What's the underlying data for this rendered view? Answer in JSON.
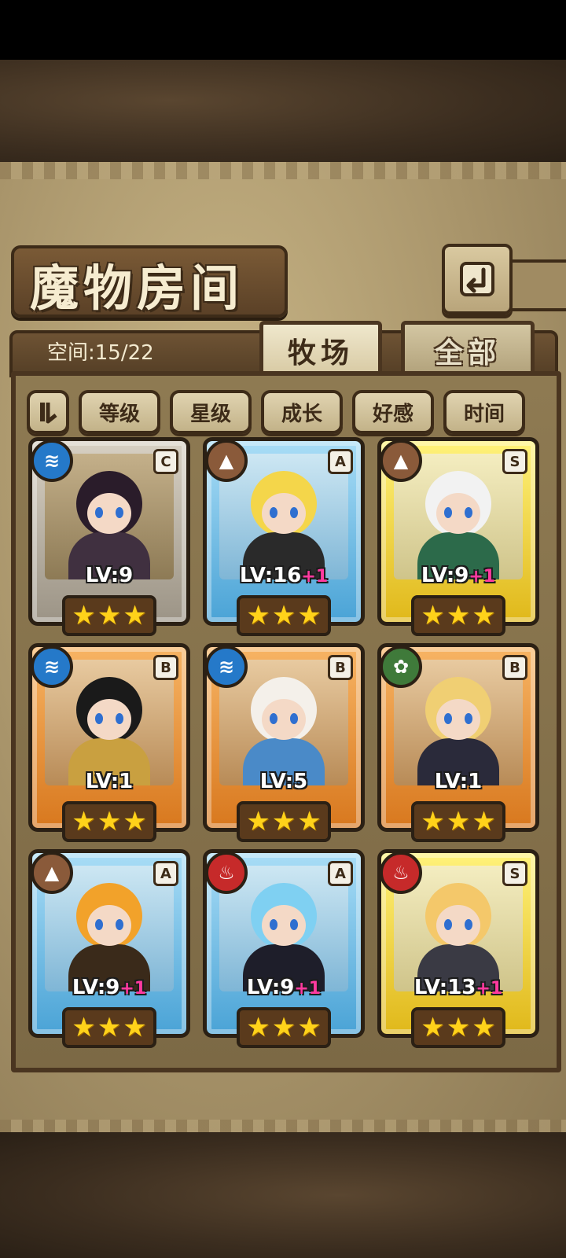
{
  "header": {
    "title": "魔物房间",
    "back_icon": "back-arrow-icon"
  },
  "status": {
    "space_label": "空间:15/22"
  },
  "tabs": [
    {
      "label": "牧场",
      "active": true
    },
    {
      "label": "全部",
      "active": false
    }
  ],
  "sort": {
    "toggle_icon": "pause-sort-icon",
    "options": [
      "等级",
      "星级",
      "成长",
      "好感",
      "时间"
    ]
  },
  "monsters": [
    {
      "rank": "C",
      "element": "water",
      "element_icon": "water-wave-icon",
      "level": "LV:9",
      "bonus": "",
      "stars": 3,
      "hair": "#2a1c2a",
      "outfit": "#403040"
    },
    {
      "rank": "A",
      "element": "earth",
      "element_icon": "mountain-icon",
      "level": "LV:16",
      "bonus": "+1",
      "stars": 3,
      "hair": "#f4d64a",
      "outfit": "#2a2a2a"
    },
    {
      "rank": "S",
      "element": "earth",
      "element_icon": "mountain-icon",
      "level": "LV:9",
      "bonus": "+1",
      "stars": 3,
      "hair": "#f2f2f2",
      "outfit": "#2c6a4a"
    },
    {
      "rank": "B",
      "element": "water",
      "element_icon": "water-wave-icon",
      "level": "LV:1",
      "bonus": "",
      "stars": 3,
      "hair": "#1a1a1a",
      "outfit": "#c9a040"
    },
    {
      "rank": "B",
      "element": "water",
      "element_icon": "water-wave-icon",
      "level": "LV:5",
      "bonus": "",
      "stars": 3,
      "hair": "#f4f0ea",
      "outfit": "#4a8ac8"
    },
    {
      "rank": "B",
      "element": "plant",
      "element_icon": "leaf-icon",
      "level": "LV:1",
      "bonus": "",
      "stars": 3,
      "hair": "#f0cf73",
      "outfit": "#2a2a3a"
    },
    {
      "rank": "A",
      "element": "earth",
      "element_icon": "mountain-icon",
      "level": "LV:9",
      "bonus": "+1",
      "stars": 3,
      "hair": "#f2a22a",
      "outfit": "#3a2a1a"
    },
    {
      "rank": "A",
      "element": "fire",
      "element_icon": "flame-icon",
      "level": "LV:9",
      "bonus": "+1",
      "stars": 3,
      "hair": "#7fd0f2",
      "outfit": "#1e1e2a"
    },
    {
      "rank": "S",
      "element": "fire",
      "element_icon": "flame-icon",
      "level": "LV:13",
      "bonus": "+1",
      "stars": 3,
      "hair": "#f4c86a",
      "outfit": "#3a3a44"
    }
  ]
}
